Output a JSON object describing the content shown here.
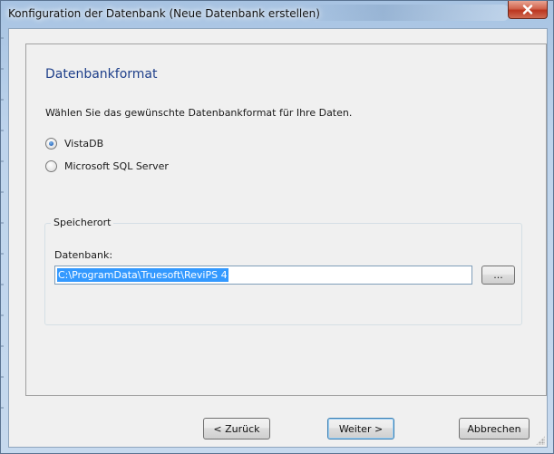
{
  "window": {
    "title": "Konfiguration der Datenbank (Neue Datenbank erstellen)"
  },
  "page": {
    "heading": "Datenbankformat",
    "instruction": "Wählen Sie das gewünschte Datenbankformat für Ihre Daten."
  },
  "format_options": [
    {
      "label": "VistaDB",
      "selected": true
    },
    {
      "label": "Microsoft SQL Server",
      "selected": false
    }
  ],
  "storage": {
    "group_label": "Speicherort",
    "field_label": "Datenbank:",
    "path_value": "C:\\ProgramData\\Truesoft\\ReviPS 4",
    "browse_label": "..."
  },
  "buttons": {
    "back": "< Zurück",
    "next": "Weiter >",
    "cancel": "Abbrechen"
  },
  "colors": {
    "heading": "#1e3f8a",
    "close_button": "#c9452d",
    "selection": "#3399ff"
  }
}
